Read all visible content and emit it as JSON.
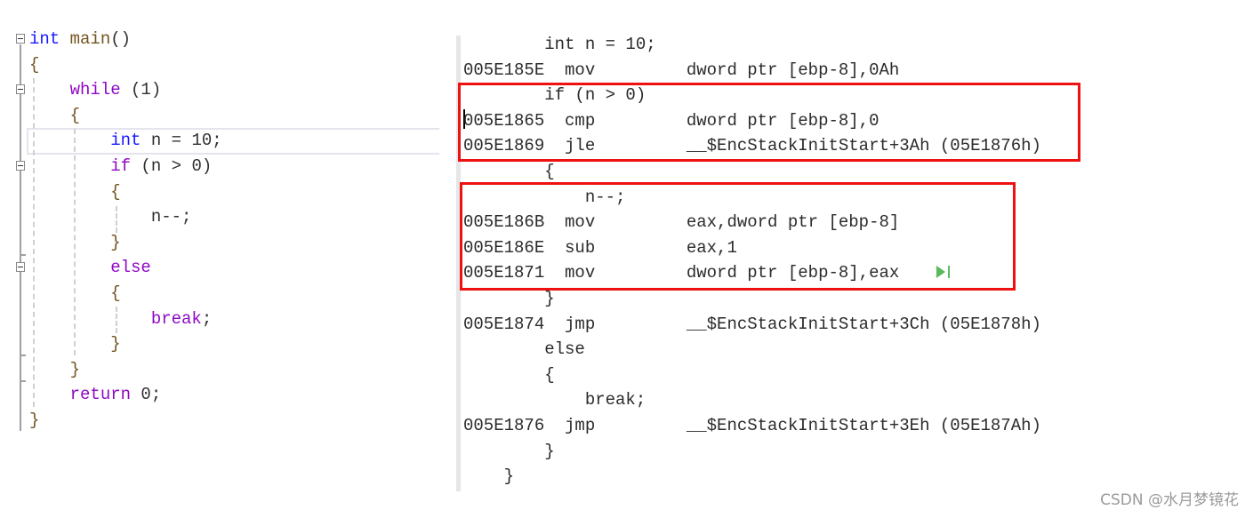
{
  "source_editor": {
    "lines": [
      [
        {
          "t": "int",
          "c": "kw"
        },
        {
          "t": " "
        },
        {
          "t": "main",
          "c": "fn"
        },
        {
          "t": "()",
          "c": "pn"
        }
      ],
      [
        {
          "t": "{",
          "c": "fn"
        }
      ],
      [
        {
          "t": "    "
        },
        {
          "t": "while",
          "c": "ctl"
        },
        {
          "t": " (1)",
          "c": "pn"
        }
      ],
      [
        {
          "t": "    "
        },
        {
          "t": "{",
          "c": "fn"
        }
      ],
      [
        {
          "t": "        "
        },
        {
          "t": "int",
          "c": "kw"
        },
        {
          "t": " n = 10;",
          "c": "pn"
        }
      ],
      [
        {
          "t": "        "
        },
        {
          "t": "if",
          "c": "ctl"
        },
        {
          "t": " (n > 0)",
          "c": "pn"
        }
      ],
      [
        {
          "t": "        "
        },
        {
          "t": "{",
          "c": "fn"
        }
      ],
      [
        {
          "t": "            "
        },
        {
          "t": "n--;",
          "c": "pn"
        }
      ],
      [
        {
          "t": "        "
        },
        {
          "t": "}",
          "c": "fn"
        }
      ],
      [
        {
          "t": "        "
        },
        {
          "t": "else",
          "c": "ctl"
        }
      ],
      [
        {
          "t": "        "
        },
        {
          "t": "{",
          "c": "fn"
        }
      ],
      [
        {
          "t": "            "
        },
        {
          "t": "break",
          "c": "ctl"
        },
        {
          "t": ";",
          "c": "pn"
        }
      ],
      [
        {
          "t": "        "
        },
        {
          "t": "}",
          "c": "fn"
        }
      ],
      [
        {
          "t": "    "
        },
        {
          "t": "}",
          "c": "fn"
        }
      ],
      [
        {
          "t": "    "
        },
        {
          "t": "return",
          "c": "ctl"
        },
        {
          "t": " 0;",
          "c": "pn"
        }
      ],
      [
        {
          "t": "}",
          "c": "fn"
        }
      ]
    ]
  },
  "disassembly": {
    "lines": [
      "        int n = 10;",
      "005E185E  mov         dword ptr [ebp-8],0Ah",
      "        if (n > 0)",
      "005E1865  cmp         dword ptr [ebp-8],0",
      "005E1869  jle         __$EncStackInitStart+3Ah (05E1876h)",
      "        {",
      "            n--;",
      "005E186B  mov         eax,dword ptr [ebp-8]",
      "005E186E  sub         eax,1",
      "005E1871  mov         dword ptr [ebp-8],eax",
      "        }",
      "005E1874  jmp         __$EncStackInitStart+3Ch (05E1878h)",
      "        else",
      "        {",
      "            break;",
      "005E1876  jmp         __$EncStackInitStart+3Eh (05E187Ah)",
      "        }",
      "    }"
    ],
    "highlight_color": "#ee1111",
    "run_to_cursor_icon": "run-to-cursor-icon"
  },
  "watermark": "CSDN @水月梦镜花"
}
